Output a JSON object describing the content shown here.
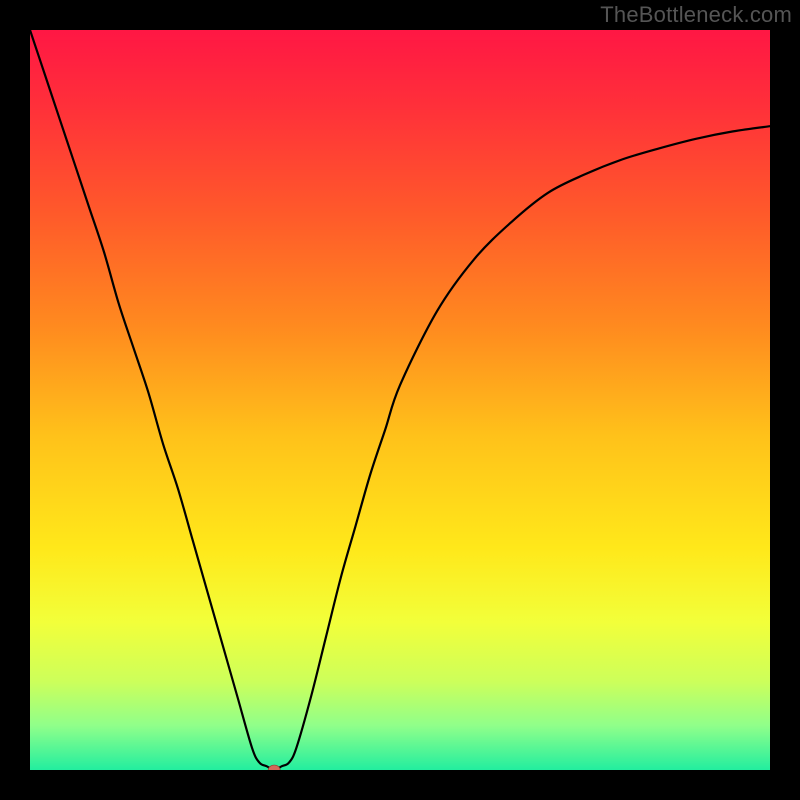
{
  "watermark": "TheBottleneck.com",
  "chart_data": {
    "type": "line",
    "title": "",
    "xlabel": "",
    "ylabel": "",
    "xlim": [
      0,
      100
    ],
    "ylim": [
      0,
      100
    ],
    "grid": false,
    "legend": false,
    "background_gradient": {
      "stops": [
        {
          "offset": 0.0,
          "color": "#ff1744"
        },
        {
          "offset": 0.1,
          "color": "#ff2f3a"
        },
        {
          "offset": 0.25,
          "color": "#ff5a2a"
        },
        {
          "offset": 0.4,
          "color": "#ff8a1f"
        },
        {
          "offset": 0.55,
          "color": "#ffc21a"
        },
        {
          "offset": 0.7,
          "color": "#ffe81a"
        },
        {
          "offset": 0.8,
          "color": "#f2ff3a"
        },
        {
          "offset": 0.88,
          "color": "#cdff5a"
        },
        {
          "offset": 0.94,
          "color": "#90ff8a"
        },
        {
          "offset": 1.0,
          "color": "#22ee9f"
        }
      ]
    },
    "series": [
      {
        "name": "bottleneck-curve",
        "color": "#000000",
        "x": [
          0,
          2,
          4,
          6,
          8,
          10,
          12,
          14,
          16,
          18,
          20,
          22,
          24,
          26,
          28,
          30,
          31,
          32,
          33,
          34,
          35,
          36,
          38,
          40,
          42,
          44,
          46,
          48,
          50,
          55,
          60,
          65,
          70,
          75,
          80,
          85,
          90,
          95,
          100
        ],
        "y": [
          100,
          94,
          88,
          82,
          76,
          70,
          63,
          57,
          51,
          44,
          38,
          31,
          24,
          17,
          10,
          3,
          1,
          0.5,
          0,
          0.5,
          1,
          3,
          10,
          18,
          26,
          33,
          40,
          46,
          52,
          62,
          69,
          74,
          78,
          80.5,
          82.5,
          84,
          85.3,
          86.3,
          87
        ]
      }
    ],
    "marker": {
      "name": "optimal-point",
      "x": 33,
      "y": 0,
      "color": "#d36a5a",
      "rx": 6,
      "ry": 5
    }
  }
}
